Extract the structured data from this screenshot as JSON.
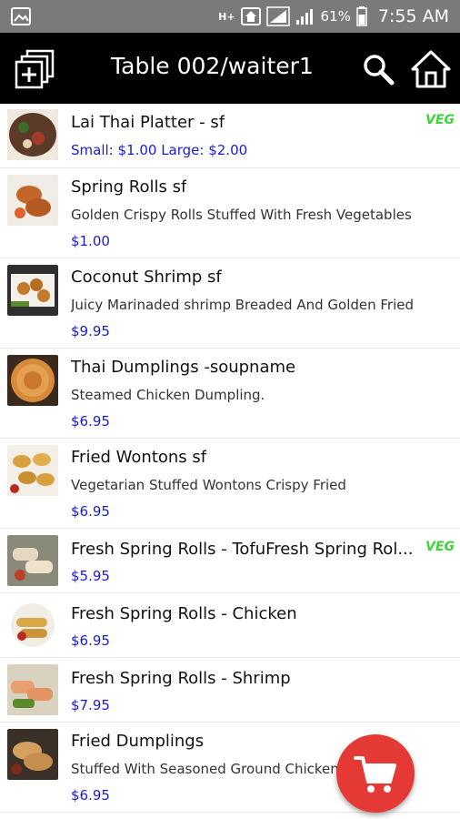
{
  "status_bar": {
    "network": "H+",
    "battery_percent": "61%",
    "time": "7:55 AM"
  },
  "app_bar": {
    "title": "Table 002/waiter1"
  },
  "colors": {
    "app_bar": "#000000",
    "status_bar": "#7a7a7a",
    "price": "#1a1ad6",
    "veg": "#3ad33a",
    "cart_fab": "#e53935"
  },
  "menu_items": [
    {
      "name": "Lai Thai Platter - sf",
      "description": "",
      "price": "Small: $1.00  Large: $2.00",
      "badge": "VEG",
      "thumb": "platter-thumb"
    },
    {
      "name": "Spring Rolls sf",
      "description": "Golden Crispy Rolls Stuffed With Fresh Vegetables",
      "price": "$1.00",
      "badge": "",
      "thumb": "spring-rolls-thumb"
    },
    {
      "name": "Coconut Shrimp sf",
      "description": "Juicy Marinaded shrimp Breaded And Golden Fried",
      "price": "$9.95",
      "badge": "",
      "thumb": "coconut-shrimp-thumb"
    },
    {
      "name": "Thai Dumplings -soupname",
      "description": "Steamed Chicken Dumpling.",
      "price": "$6.95",
      "badge": "",
      "thumb": "thai-dumplings-thumb"
    },
    {
      "name": "Fried Wontons sf",
      "description": "Vegetarian Stuffed Wontons Crispy Fried",
      "price": "$6.95",
      "badge": "",
      "thumb": "fried-wontons-thumb"
    },
    {
      "name": " Fresh Spring Rolls - TofuFresh Spring Rol...",
      "description": "",
      "price": "$5.95",
      "badge": "VEG",
      "thumb": "fresh-rolls-tofu-thumb"
    },
    {
      "name": "Fresh Spring Rolls - Chicken",
      "description": "",
      "price": "$6.95",
      "badge": "",
      "thumb": "fresh-rolls-chicken-thumb"
    },
    {
      "name": "Fresh Spring Rolls - Shrimp",
      "description": "",
      "price": "$7.95",
      "badge": "",
      "thumb": "fresh-rolls-shrimp-thumb"
    },
    {
      "name": "Fried Dumplings",
      "description": "Stuffed With Seasoned Ground Chicken",
      "price": "$6.95",
      "badge": "",
      "thumb": "fried-dumplings-thumb"
    }
  ]
}
